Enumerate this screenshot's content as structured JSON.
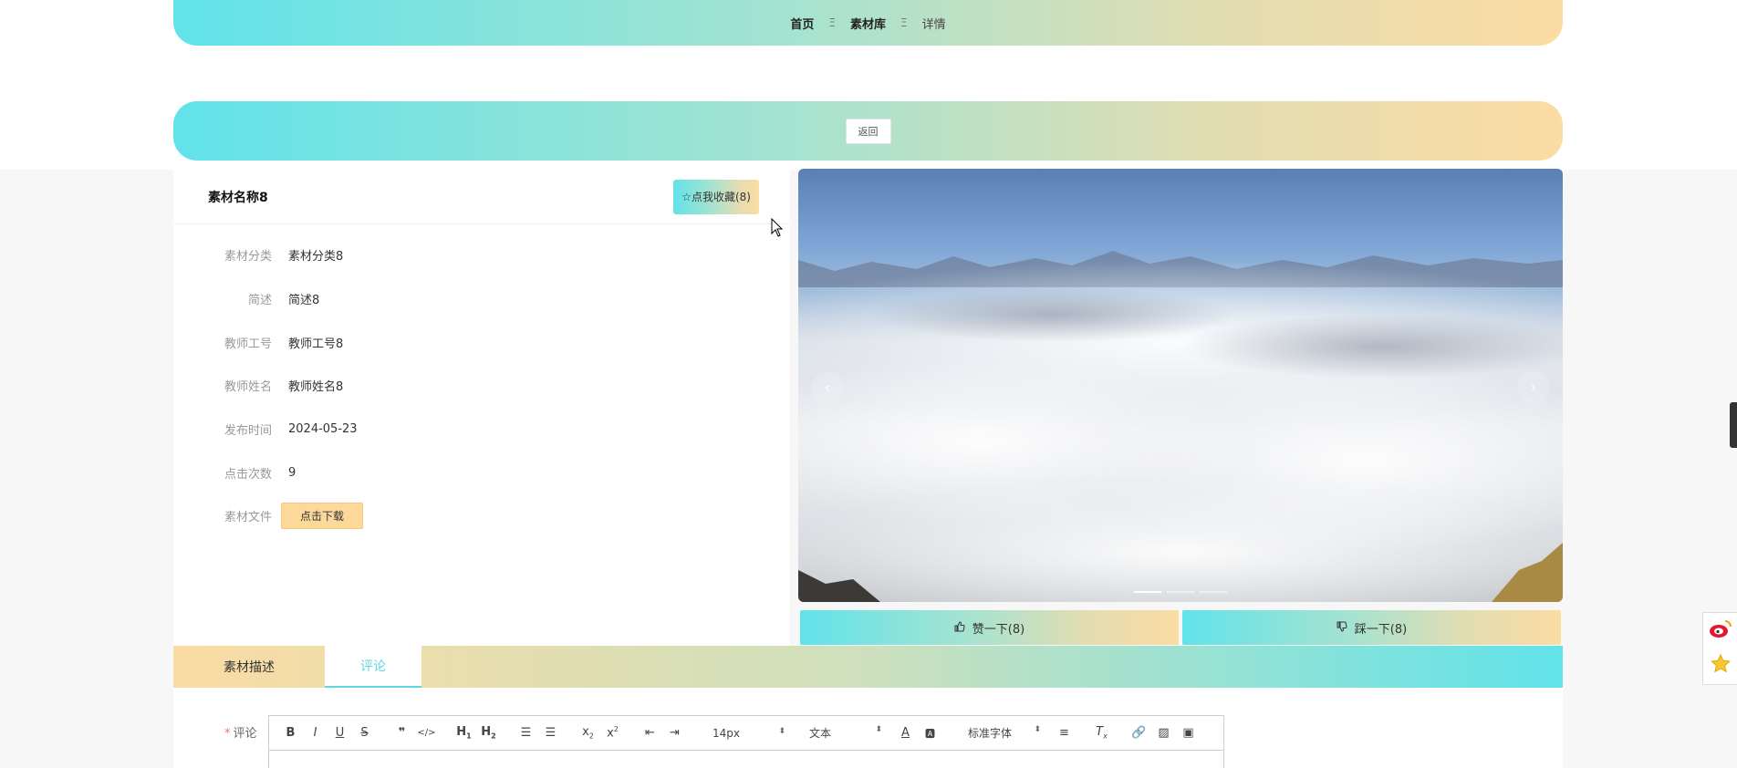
{
  "breadcrumb": {
    "home": "首页",
    "sep1": "Ξ",
    "library": "素材库",
    "sep2": "Ξ",
    "current": "详情"
  },
  "back_label": "返回",
  "detail": {
    "title": "素材名称8",
    "favorite_label": "☆点我收藏(8)",
    "fields": [
      {
        "label": "素材分类",
        "value": "素材分类8"
      },
      {
        "label": "简述",
        "value": "简述8"
      },
      {
        "label": "教师工号",
        "value": "教师工号8"
      },
      {
        "label": "教师姓名",
        "value": "教师姓名8"
      },
      {
        "label": "发布时间",
        "value": "2024-05-23"
      },
      {
        "label": "点击次数",
        "value": "9"
      }
    ],
    "file_label": "素材文件",
    "download_label": "点击下载"
  },
  "carousel": {
    "prev_icon": "‹",
    "next_icon": "›",
    "slide_count": 3,
    "active_index": 0
  },
  "votes": {
    "like_label": "赞一下(8)",
    "dislike_label": "踩一下(8)"
  },
  "tabs": [
    {
      "label": "素材描述",
      "active": false
    },
    {
      "label": "评论",
      "active": true
    }
  ],
  "comment": {
    "label": "评论",
    "required_mark": "*",
    "toolbar": {
      "font_size": "14px",
      "block_type": "文本",
      "font_family": "标准字体"
    }
  },
  "colors": {
    "gradient_start": "#61e3ea",
    "gradient_end": "#fbdca3",
    "active_tab": "#61d6e0",
    "download": "#fcd99a"
  }
}
